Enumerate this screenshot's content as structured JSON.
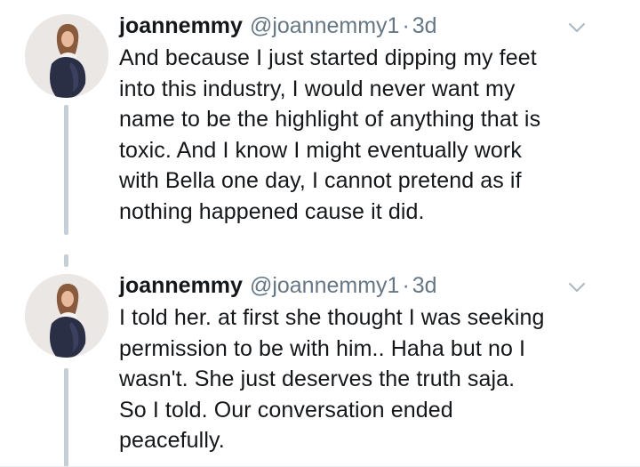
{
  "tweets": [
    {
      "display_name": "joannemmy",
      "handle": "@joannemmy1",
      "separator": "·",
      "time": "3d",
      "text_lines": [
        "And because I just started dipping my feet",
        "into this industry, I would never want my",
        "name to be the highlight of anything that is",
        "toxic. And I know I might eventually work",
        "with Bella one day, I cannot pretend as if",
        "nothing happened cause it did."
      ]
    },
    {
      "display_name": "joannemmy",
      "handle": "@joannemmy1",
      "separator": "·",
      "time": "3d",
      "text_lines": [
        "I told her. at first she thought I was seeking",
        "permission to be with him.. Haha but no I",
        "wasn't. She just deserves the truth saja.",
        "So I told. Our conversation ended",
        "peacefully."
      ]
    }
  ],
  "icons": {
    "more": "chevron-down-icon",
    "avatar": "profile-photo"
  },
  "colors": {
    "name": "#14171a",
    "secondary": "#657786",
    "thread_line": "#c4cfd6",
    "chevron": "#aab8c2"
  }
}
